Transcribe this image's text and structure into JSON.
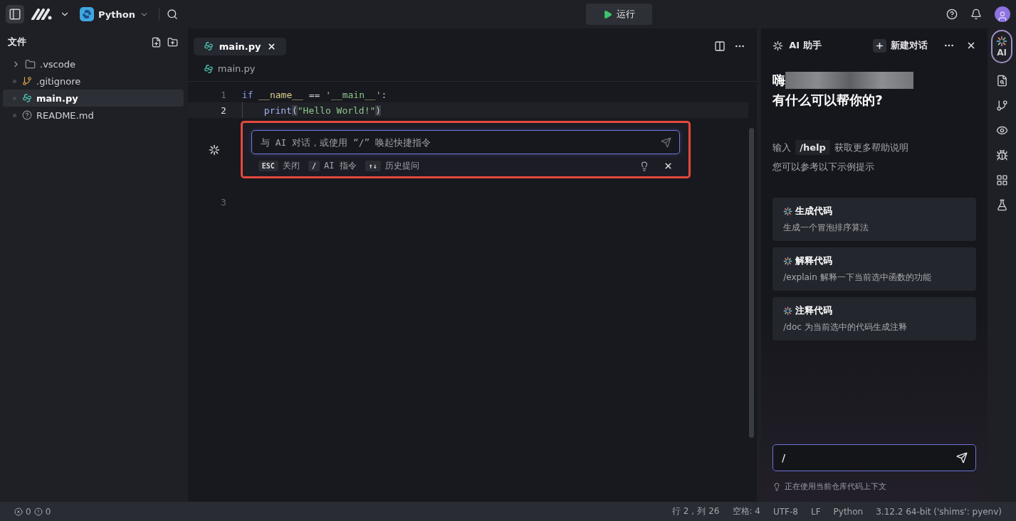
{
  "topbar": {
    "project": "Python",
    "run_label": "运行"
  },
  "explorer": {
    "title": "文件",
    "items": [
      {
        "name": ".vscode",
        "kind": "folder",
        "selected": false
      },
      {
        "name": ".gitignore",
        "kind": "git",
        "selected": false
      },
      {
        "name": "main.py",
        "kind": "python",
        "selected": true
      },
      {
        "name": "README.md",
        "kind": "help",
        "selected": false
      }
    ]
  },
  "editor": {
    "tabs": [
      {
        "label": "main.py",
        "selected": true
      }
    ],
    "breadcrumb": "main.py",
    "lines": [
      {
        "number": "1",
        "active": false,
        "indent": false,
        "tokens": [
          {
            "kind": "keyword",
            "text": "if"
          },
          {
            "kind": "dunder",
            "text": " __name__"
          },
          {
            "kind": "plain",
            "text": " == "
          },
          {
            "kind": "string",
            "text": "'__main__'"
          },
          {
            "kind": "plain",
            "text": ":"
          }
        ]
      },
      {
        "number": "2",
        "active": true,
        "indent": true,
        "tokens": [
          {
            "kind": "func",
            "text": "print"
          },
          {
            "kind": "bracket",
            "text": "("
          },
          {
            "kind": "string",
            "text": "\"Hello World!\""
          },
          {
            "kind": "bracket",
            "text": ")"
          }
        ]
      }
    ],
    "inline_chat": {
      "placeholder": "与 AI 对话，或使用 “/” 唤起快捷指令",
      "hints": [
        {
          "key": "ESC",
          "label": "关闭"
        },
        {
          "key": "/",
          "label": "AI 指令"
        },
        {
          "key": "↑↓",
          "label": "历史提问"
        }
      ]
    },
    "after_lines": [
      {
        "number": "3",
        "active": false
      }
    ]
  },
  "ai_panel": {
    "title": "AI 助手",
    "new_chat": "新建对话",
    "greeting": "嗨",
    "question": "有什么可以帮你的?",
    "help_prefix": "输入",
    "help_command": "/help",
    "help_suffix": "获取更多帮助说明",
    "hint": "您可以参考以下示例提示",
    "cards": [
      {
        "title": "生成代码",
        "text": "生成一个冒泡排序算法"
      },
      {
        "title": "解释代码",
        "text": "/explain 解释一下当前选中函数的功能"
      },
      {
        "title": "注释代码",
        "text": "/doc 为当前选中的代码生成注释"
      }
    ],
    "input_value": "/",
    "context": "正在使用当前仓库代码上下文"
  },
  "activity_bar": [
    {
      "kind": "ai",
      "label": "AI",
      "selected": true
    },
    {
      "kind": "file-search",
      "selected": false
    },
    {
      "kind": "branch",
      "selected": false
    },
    {
      "kind": "eye",
      "selected": false
    },
    {
      "kind": "bug",
      "selected": false
    },
    {
      "kind": "grid",
      "selected": false
    },
    {
      "kind": "flask",
      "selected": false
    }
  ],
  "status_bar": {
    "errors": "0",
    "warnings": "0",
    "items": [
      "行 2，列 26",
      "空格: 4",
      "UTF-8",
      "LF",
      "Python",
      "3.12.2 64-bit ('shims': pyenv)"
    ]
  }
}
